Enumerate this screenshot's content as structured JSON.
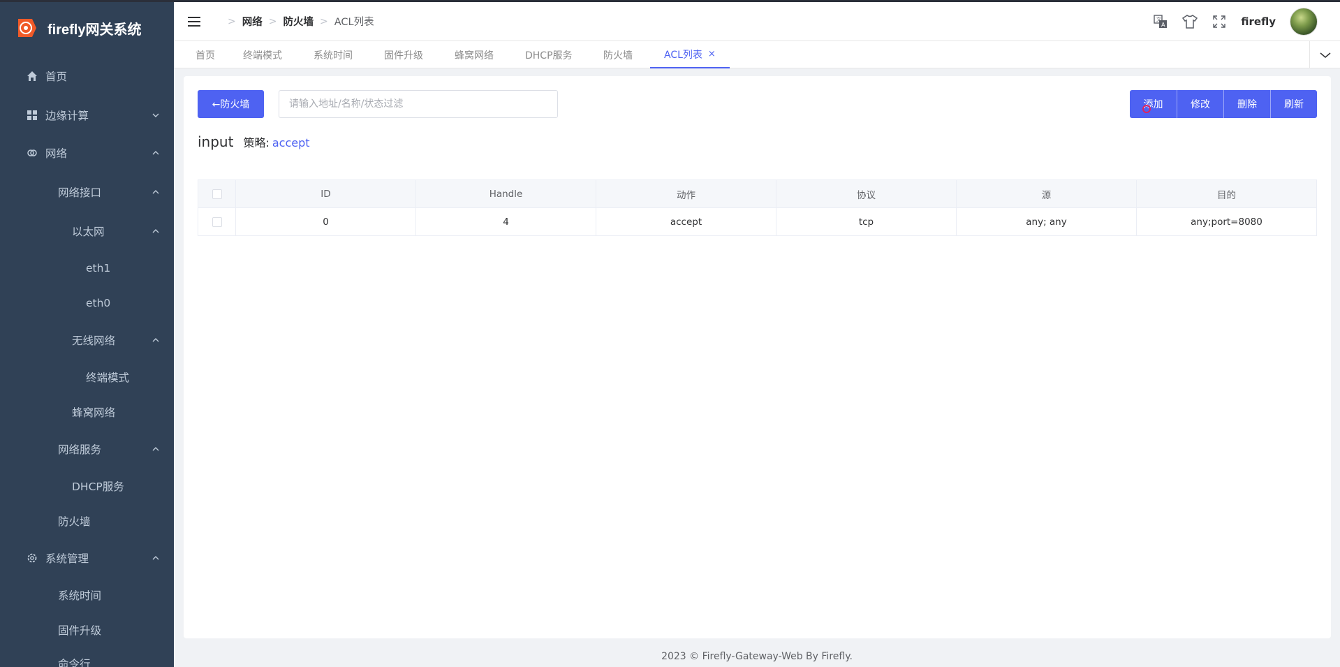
{
  "app": {
    "title": "firefly网关系统"
  },
  "sidebar": {
    "items": [
      {
        "label": "首页"
      },
      {
        "label": "边缘计算"
      },
      {
        "label": "网络"
      },
      {
        "label": "网络接口"
      },
      {
        "label": "以太网"
      },
      {
        "label": "eth1"
      },
      {
        "label": "eth0"
      },
      {
        "label": "无线网络"
      },
      {
        "label": "终端模式"
      },
      {
        "label": "蜂窝网络"
      },
      {
        "label": "网络服务"
      },
      {
        "label": "DHCP服务"
      },
      {
        "label": "防火墙"
      },
      {
        "label": "系统管理"
      },
      {
        "label": "系统时间"
      },
      {
        "label": "固件升级"
      },
      {
        "label": "命令行"
      }
    ]
  },
  "breadcrumb": [
    "网络",
    "防火墙",
    "ACL列表"
  ],
  "user": {
    "name": "firefly"
  },
  "tags": [
    {
      "label": "首页"
    },
    {
      "label": "终端模式"
    },
    {
      "label": "系统时间"
    },
    {
      "label": "固件升级"
    },
    {
      "label": "蜂窝网络"
    },
    {
      "label": "DHCP服务"
    },
    {
      "label": "防火墙"
    },
    {
      "label": "ACL列表",
      "close": "×"
    }
  ],
  "toolbar": {
    "back_label": "←防火墙",
    "search_placeholder": "请输入地址/名称/状态过滤",
    "add_label": "添加",
    "edit_label": "修改",
    "delete_label": "删除",
    "refresh_label": "刷新"
  },
  "chain": {
    "name": "input",
    "policy_label": "策略:",
    "policy_value": "accept"
  },
  "table": {
    "headers": [
      "ID",
      "Handle",
      "动作",
      "协议",
      "源",
      "目的"
    ],
    "rows": [
      [
        "0",
        "4",
        "accept",
        "tcp",
        "any; any",
        "any;port=8080"
      ]
    ]
  },
  "footer": {
    "text": "2023 © Firefly-Gateway-Web By Firefly."
  },
  "colors": {
    "primary": "#4e62f2",
    "sidebar_bg": "#304156",
    "sidebar_text": "#bfcbd9"
  }
}
